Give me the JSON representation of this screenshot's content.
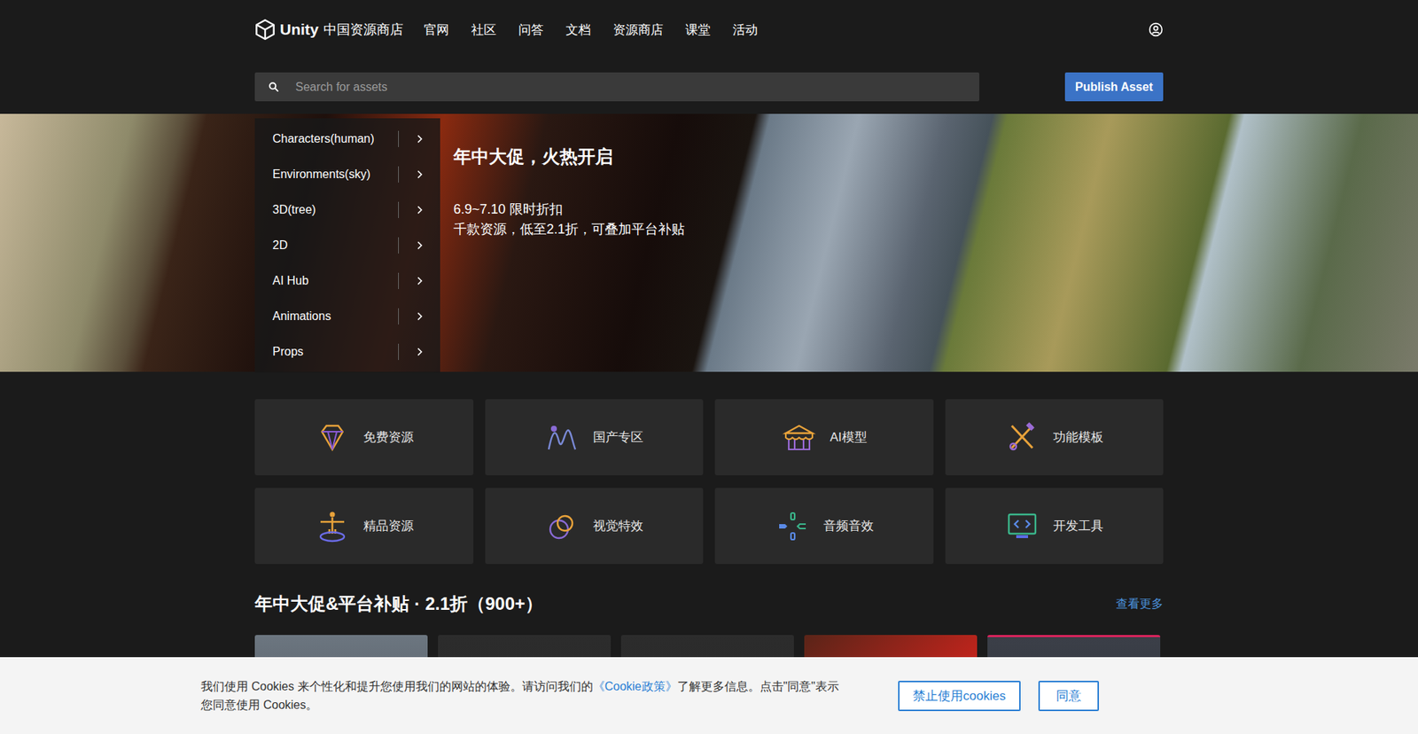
{
  "header": {
    "logo": "Unity",
    "store_name": "中国资源商店",
    "nav": [
      "官网",
      "社区",
      "问答",
      "文档",
      "资源商店",
      "课堂",
      "活动"
    ]
  },
  "search": {
    "placeholder": "Search for assets"
  },
  "publish_button": "Publish Asset",
  "categories": [
    "Characters(human)",
    "Environments(sky)",
    "3D(tree)",
    "2D",
    "AI Hub",
    "Animations",
    "Props"
  ],
  "hero": {
    "title": "年中大促，火热开启",
    "lines": [
      "6.9~7.10 限时折扣",
      "千款资源，低至2.1折，可叠加平台补贴"
    ]
  },
  "tiles": [
    "免费资源",
    "国产专区",
    "AI模型",
    "功能模板",
    "精品资源",
    "视觉特效",
    "音频音效",
    "开发工具"
  ],
  "section": {
    "title": "年中大促&平台补贴 · 2.1折（900+）",
    "more": "查看更多"
  },
  "cookie": {
    "text_before": "我们使用 Cookies 来个性化和提升您使用我们的网站的体验。请访问我们的",
    "link": "《Cookie政策》",
    "text_after": "了解更多信息。点击\"同意\"表示您同意使用 Cookies。",
    "buttons": [
      "禁止使用cookies",
      "同意"
    ]
  }
}
